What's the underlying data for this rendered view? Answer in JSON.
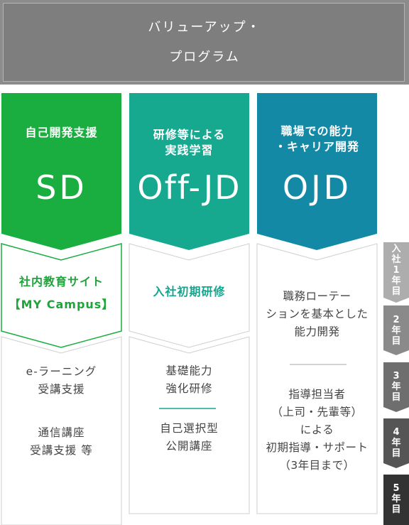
{
  "header": {
    "title_line1": "バリューアップ・",
    "title_line2": "プログラム"
  },
  "columns": [
    {
      "header_line1": "自己開発支援",
      "header_line2": "",
      "code": "SD",
      "color": "#1aad3f",
      "sub_lines": [
        "社内教育サイト",
        "【MY Campus】"
      ],
      "body_lines": [
        "e-ラーニング",
        "受講支援"
      ],
      "body2_lines": [
        "通信講座",
        "受講支援 等"
      ]
    },
    {
      "header_line1": "研修等による",
      "header_line2": "実践学習",
      "code": "Off-JD",
      "color": "#17a890",
      "sub_lines": [
        "入社初期研修"
      ],
      "body_lines": [
        "基礎能力",
        "強化研修"
      ],
      "body2_lines": [
        "自己選択型",
        "公開講座"
      ]
    },
    {
      "header_line1": "職場での能力",
      "header_line2": "・キャリア開発",
      "code": "OJD",
      "color": "#1489a6",
      "sub_lines": [
        "職務ローテー",
        "ションを基本とした",
        "能力開発"
      ],
      "body_lines": [
        "指導担当者",
        "（上司・先輩等）",
        "による",
        "初期指導・サポート",
        "（3年目まで）"
      ],
      "body2_lines": []
    }
  ],
  "years": [
    {
      "label": "入社1年目",
      "color": "#adadad"
    },
    {
      "label": "2年目",
      "color": "#8a8a8a"
    },
    {
      "label": "3年目",
      "color": "#6e6e6e"
    },
    {
      "label": "4年目",
      "color": "#555555"
    },
    {
      "label": "5年目",
      "color": "#333333"
    }
  ]
}
